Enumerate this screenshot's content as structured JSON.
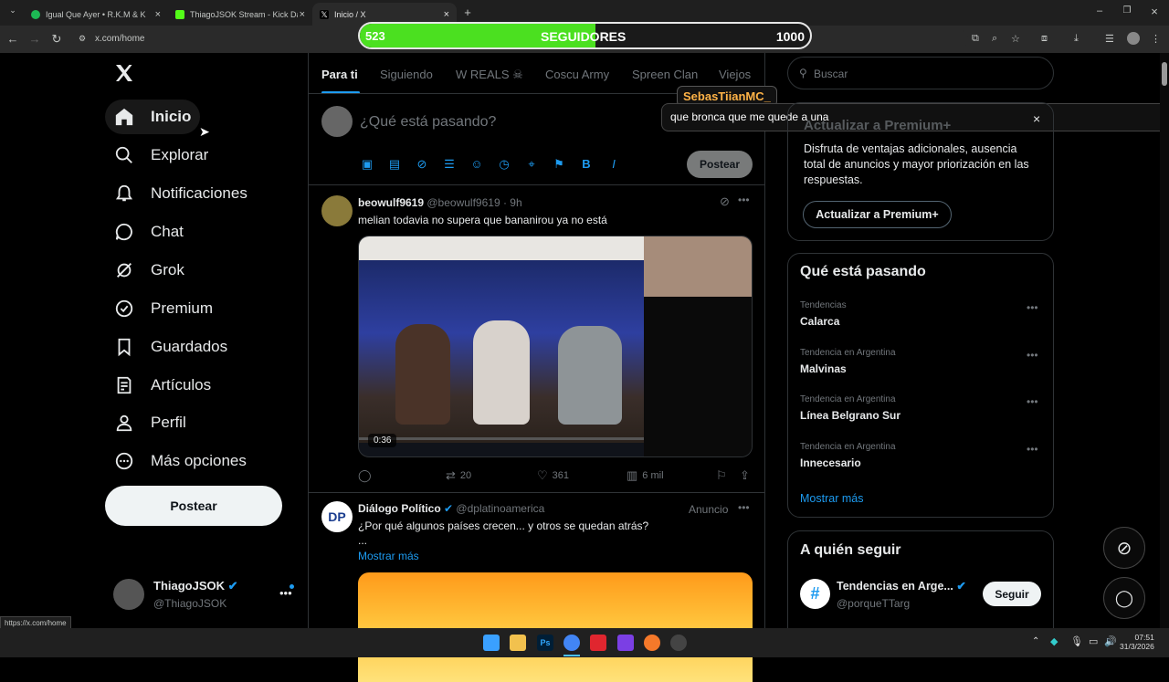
{
  "browser": {
    "tabs": [
      {
        "title": "Igual Que Ayer • R.K.M & K",
        "favicon_color": "#1db954"
      },
      {
        "title": "ThiagoJSOK Stream - Kick Dash",
        "favicon_color": "#53fc18"
      },
      {
        "title": "Inicio / X",
        "favicon_color": "#ffffff"
      }
    ],
    "url": "x.com/home",
    "status_url": "https://x.com/home"
  },
  "overlay": {
    "current": "523",
    "label": "SEGUIDORES",
    "goal": "1000",
    "progress": 0.523,
    "fill_color": "#4be020"
  },
  "sidebar": {
    "items": [
      {
        "label": "Inicio",
        "icon": "home-icon"
      },
      {
        "label": "Explorar",
        "icon": "search-icon"
      },
      {
        "label": "Notificaciones",
        "icon": "bell-icon"
      },
      {
        "label": "Chat",
        "icon": "chat-icon"
      },
      {
        "label": "Grok",
        "icon": "grok-icon"
      },
      {
        "label": "Premium",
        "icon": "verified-icon"
      },
      {
        "label": "Guardados",
        "icon": "bookmark-icon"
      },
      {
        "label": "Artículos",
        "icon": "article-icon"
      },
      {
        "label": "Perfil",
        "icon": "person-icon"
      },
      {
        "label": "Más opciones",
        "icon": "more-icon"
      }
    ],
    "post_label": "Postear",
    "account": {
      "name": "ThiagoJSOK",
      "handle": "@ThiagoJSOK"
    }
  },
  "feed": {
    "tabs": [
      "Para ti",
      "Siguiendo",
      "W REALS ☠",
      "Coscu Army",
      "Spreen Clan",
      "Viejos"
    ],
    "composer_placeholder": "¿Qué está pasando?",
    "composer_post": "Postear",
    "posts": [
      {
        "author": "beowulf9619",
        "handle": "@beowulf9619",
        "time": "· 9h",
        "text": "melian todavia no supera que bananirou ya no está",
        "video_time": "0:36",
        "retweets": "20",
        "likes": "361",
        "views": "6 mil"
      },
      {
        "author": "Diálogo Político",
        "handle": "@dplatinoamerica",
        "ad": "Anuncio",
        "text": "¿Por qué algunos países crecen... y otros se quedan atrás?",
        "ellipsis": "...",
        "show_more": "Mostrar más"
      }
    ]
  },
  "chat_popup": {
    "user": "SebasTiianMC_",
    "message": "que bronca que me quede a una"
  },
  "right": {
    "search_placeholder": "Buscar",
    "premium": {
      "title": "Actualizar a Premium+",
      "body": "Disfruta de ventajas adicionales, ausencia total de anuncios y mayor priorización en las respuestas.",
      "button": "Actualizar a Premium+"
    },
    "trends": {
      "title": "Qué está pasando",
      "items": [
        {
          "category": "Tendencias",
          "name": "Calarca"
        },
        {
          "category": "Tendencia en Argentina",
          "name": "Malvinas"
        },
        {
          "category": "Tendencia en Argentina",
          "name": "Línea Belgrano Sur"
        },
        {
          "category": "Tendencia en Argentina",
          "name": "Innecesario"
        }
      ],
      "show_more": "Mostrar más"
    },
    "follow": {
      "title": "A quién seguir",
      "name": "Tendencias en Arge...",
      "handle": "@porqueTTarg",
      "button": "Seguir"
    }
  },
  "taskbar": {
    "time": "07:51",
    "date": "31/3/2026"
  }
}
